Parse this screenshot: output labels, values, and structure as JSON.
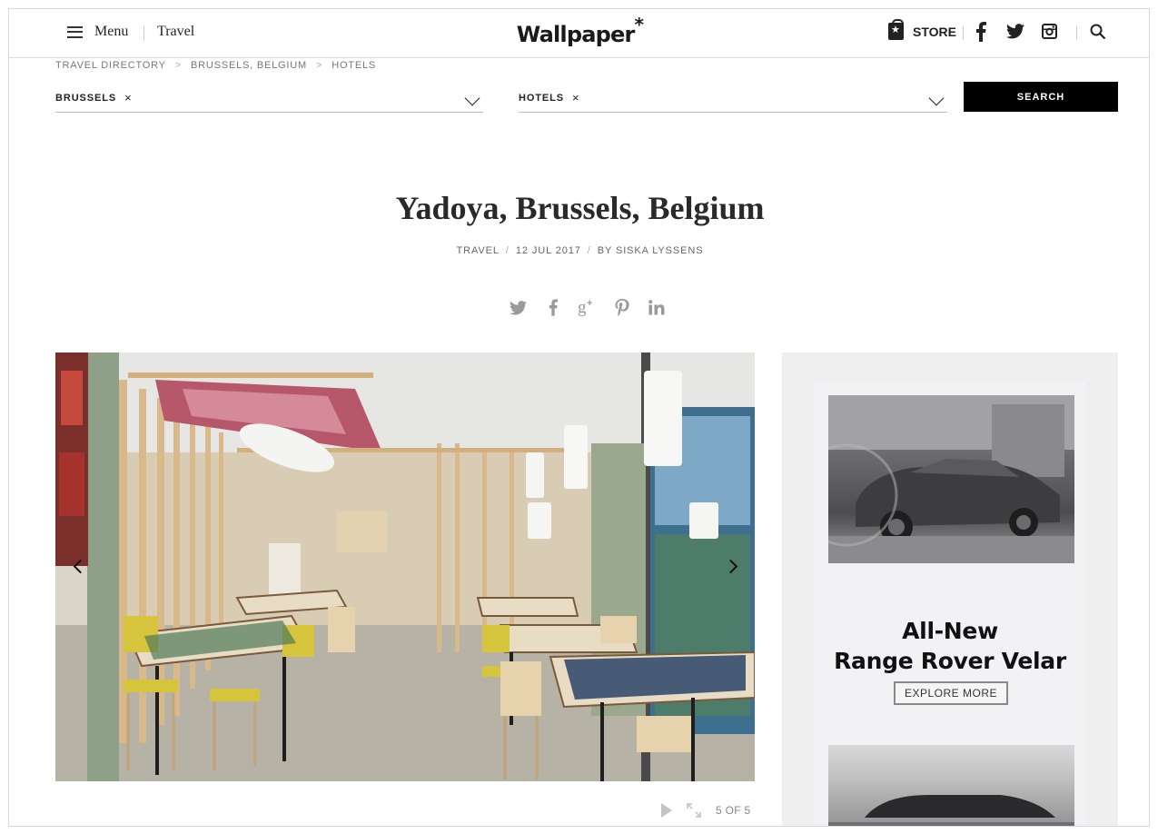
{
  "header": {
    "menu_label": "Menu",
    "section_link": "Travel",
    "logo_text": "Wallpaper",
    "logo_mark": "*",
    "store_label": "STORE",
    "icons": [
      "store-bag-icon",
      "facebook-icon",
      "twitter-icon",
      "instagram-icon",
      "search-icon"
    ]
  },
  "breadcrumb": {
    "items": [
      "TRAVEL DIRECTORY",
      "BRUSSELS, BELGIUM",
      "HOTELS"
    ],
    "separator": ">"
  },
  "filters": {
    "city": {
      "value": "BRUSSELS",
      "clear": "×"
    },
    "category": {
      "value": "HOTELS",
      "clear": "×"
    },
    "search_label": "SEARCH"
  },
  "article": {
    "title": "Yadoya, Brussels, Belgium",
    "section": "TRAVEL",
    "date": "12 JUL 2017",
    "byline": "BY SISKA LYSSENS",
    "separator": "/",
    "share_icons": [
      "twitter-icon",
      "facebook-icon",
      "google-plus-icon",
      "pinterest-icon",
      "linkedin-icon"
    ]
  },
  "gallery": {
    "counter": "5 OF 5",
    "current": 5,
    "total": 5
  },
  "ad": {
    "headline_line1": "All-New",
    "headline_line2": "Range Rover Velar",
    "cta_label": "EXPLORE MORE"
  },
  "colors": {
    "accent": "#000000",
    "text": "#222222",
    "muted": "#777777",
    "icon_gray": "#9a9a9a"
  }
}
